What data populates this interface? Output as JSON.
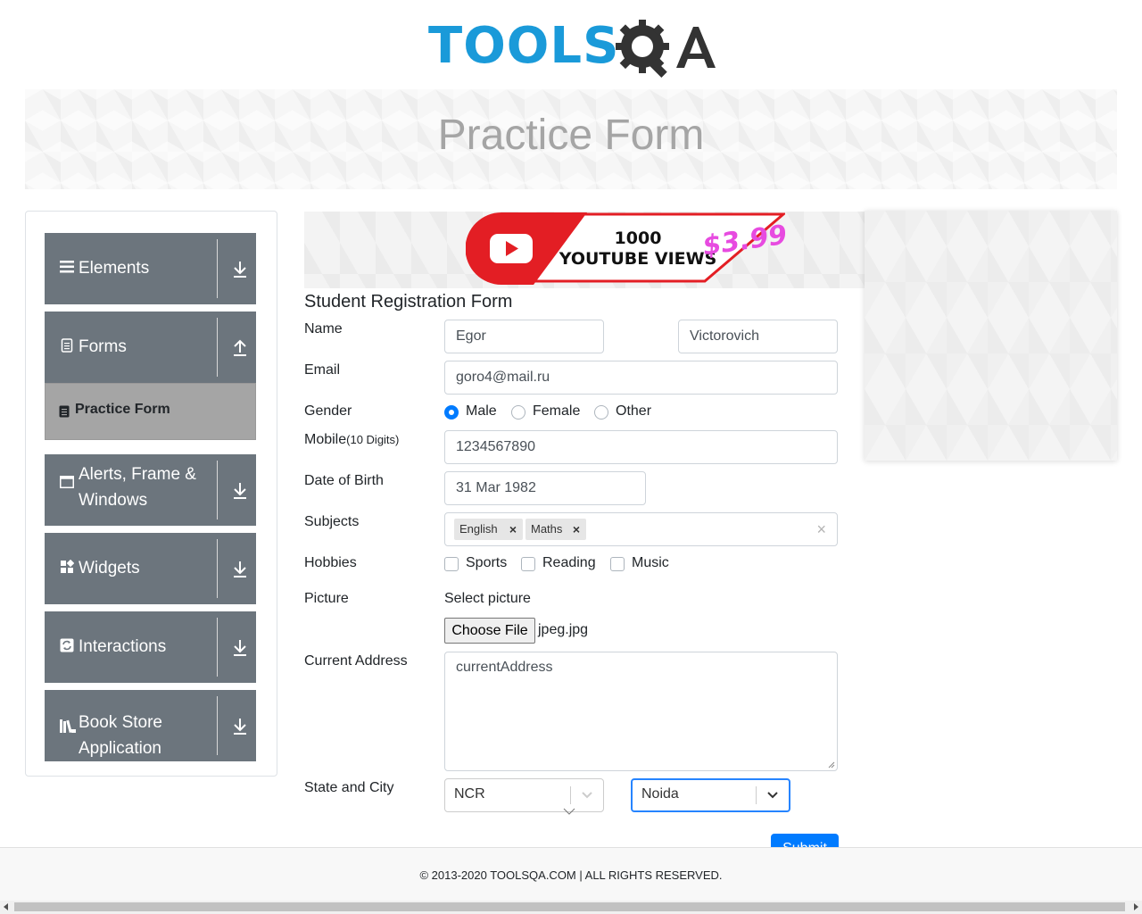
{
  "logo": {
    "text_left": "TOOLS",
    "text_right": "QA"
  },
  "banner": {
    "title": "Practice Form"
  },
  "sidebar": {
    "groups": [
      {
        "label": "Elements",
        "icon": "menu-icon"
      },
      {
        "label": "Forms",
        "icon": "document-icon"
      },
      {
        "label": "Alerts, Frame & Windows",
        "icon": "window-icon"
      },
      {
        "label": "Widgets",
        "icon": "widgets-icon"
      },
      {
        "label": "Interactions",
        "icon": "interactions-icon"
      },
      {
        "label": "Book Store Application",
        "icon": "books-icon"
      }
    ],
    "forms_subitem": {
      "label": "Practice Form"
    }
  },
  "ad": {
    "line1": "1000",
    "line2": "YOUTUBE VIEWS",
    "price": "$3.99"
  },
  "form": {
    "title": "Student Registration Form",
    "name_label": "Name",
    "first_name": "Egor",
    "last_name": "Victorovich",
    "email_label": "Email",
    "email": "goro4@mail.ru",
    "gender_label": "Gender",
    "gender_options": [
      "Male",
      "Female",
      "Other"
    ],
    "gender_selected": "Male",
    "mobile_label": "Mobile",
    "mobile_hint": "(10 Digits)",
    "mobile": "1234567890",
    "dob_label": "Date of Birth",
    "dob": "31 Mar 1982",
    "subjects_label": "Subjects",
    "subjects": [
      "English",
      "Maths"
    ],
    "clear_symbol": "×",
    "remove_symbol": "×",
    "hobbies_label": "Hobbies",
    "hobbies": [
      "Sports",
      "Reading",
      "Music"
    ],
    "picture_label": "Picture",
    "select_picture": "Select picture",
    "choose_file": "Choose File",
    "file_name": "jpeg.jpg",
    "address_label": "Current Address",
    "address_placeholder": "currentAddress",
    "state_city_label": "State and City",
    "state": "NCR",
    "city": "Noida",
    "submit": "Submit"
  },
  "footer": {
    "text": "© 2013-2020 TOOLSQA.COM | ALL RIGHTS RESERVED."
  },
  "colors": {
    "primary": "#007bff",
    "sidebar": "#6c757d",
    "logo_blue": "#1a9ad9",
    "logo_dark": "#333333"
  }
}
